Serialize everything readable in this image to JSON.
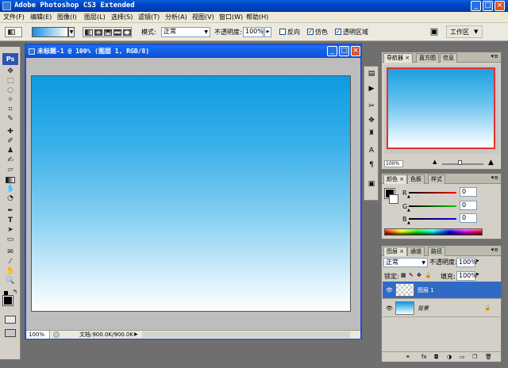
{
  "app": {
    "title": "Adobe Photoshop CS3 Extended"
  },
  "menu": [
    "文件(F)",
    "编辑(E)",
    "图像(I)",
    "图层(L)",
    "选择(S)",
    "滤镜(T)",
    "分析(A)",
    "视图(V)",
    "窗口(W)",
    "帮助(H)"
  ],
  "options": {
    "mode_label": "模式:",
    "mode_value": "正常",
    "opacity_label": "不透明度:",
    "opacity_value": "100%",
    "reverse_label": "反向",
    "dither_label": "仿色",
    "transparency_label": "透明区域",
    "workspace_label": "工作区"
  },
  "document": {
    "title": "未标题-1 @ 100% (图层 1, RGB/8)",
    "zoom": "100%",
    "doc_info": "文档:900.0K/900.0K"
  },
  "navigator": {
    "tabs": [
      "导航器",
      "直方图",
      "信息"
    ],
    "zoom": "100%"
  },
  "color": {
    "tabs": [
      "颜色",
      "色板",
      "样式"
    ],
    "r_label": "R",
    "g_label": "G",
    "b_label": "B",
    "r_value": "0",
    "g_value": "0",
    "b_value": "0"
  },
  "layers": {
    "tabs": [
      "图层",
      "通道",
      "路径"
    ],
    "blend_mode": "正常",
    "opacity_label": "不透明度:",
    "opacity_value": "100%",
    "lock_label": "锁定:",
    "fill_label": "填充:",
    "fill_value": "100%",
    "items": [
      {
        "name": "图层 1",
        "selected": true
      },
      {
        "name": "背景",
        "selected": false
      }
    ]
  },
  "colors": {
    "titlebar": "#0a4fd3",
    "canvas_top": "#0c9be0",
    "canvas_bottom": "#ffffff",
    "selection": "#316ac5"
  }
}
